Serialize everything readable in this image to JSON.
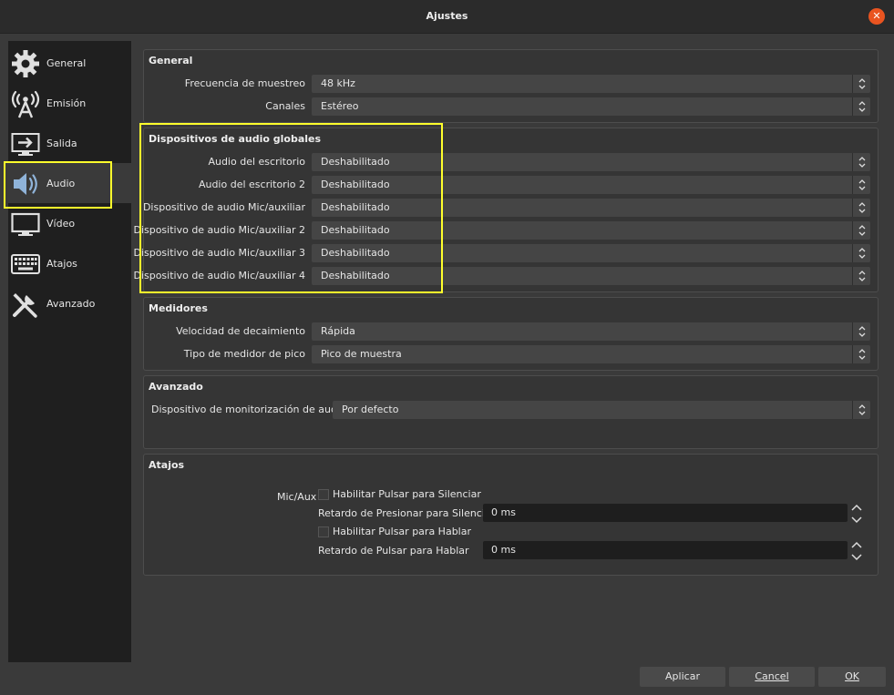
{
  "window": {
    "title": "Ajustes",
    "close_glyph": "✕"
  },
  "sidebar": {
    "items": [
      {
        "label": "General",
        "icon": "gear-icon"
      },
      {
        "label": "Emisión",
        "icon": "broadcast-antenna-icon"
      },
      {
        "label": "Salida",
        "icon": "output-monitor-icon"
      },
      {
        "label": "Audio",
        "icon": "speaker-icon",
        "selected": true
      },
      {
        "label": "Vídeo",
        "icon": "monitor-icon"
      },
      {
        "label": "Atajos",
        "icon": "keyboard-icon"
      },
      {
        "label": "Avanzado",
        "icon": "tools-icon"
      }
    ]
  },
  "general": {
    "title": "General",
    "sample_rate_label": "Frecuencia de muestreo",
    "sample_rate_value": "48 kHz",
    "channels_label": "Canales",
    "channels_value": "Estéreo"
  },
  "global_devices": {
    "title": "Dispositivos de audio globales",
    "rows": [
      {
        "label": "Audio del escritorio",
        "value": "Deshabilitado"
      },
      {
        "label": "Audio del escritorio 2",
        "value": "Deshabilitado"
      },
      {
        "label": "Dispositivo de audio Mic/auxiliar",
        "value": "Deshabilitado"
      },
      {
        "label": "Dispositivo de audio Mic/auxiliar 2",
        "value": "Deshabilitado"
      },
      {
        "label": "Dispositivo de audio Mic/auxiliar 3",
        "value": "Deshabilitado"
      },
      {
        "label": "Dispositivo de audio Mic/auxiliar 4",
        "value": "Deshabilitado"
      }
    ]
  },
  "meters": {
    "title": "Medidores",
    "decay_label": "Velocidad de decaimiento",
    "decay_value": "Rápida",
    "peak_label": "Tipo de medidor de pico",
    "peak_value": "Pico de muestra"
  },
  "advanced": {
    "title": "Avanzado",
    "monitor_label": "Dispositivo de monitorización de audio",
    "monitor_value": "Por defecto"
  },
  "hotkeys": {
    "title": "Atajos",
    "source_label": "Mic/Aux",
    "push_to_mute_label": "Habilitar Pulsar para Silenciar",
    "push_to_mute_checked": false,
    "push_to_mute_delay_label": "Retardo de Presionar para Silenciar",
    "push_to_mute_delay_value": "0 ms",
    "push_to_talk_label": "Habilitar Pulsar para Hablar",
    "push_to_talk_checked": false,
    "push_to_talk_delay_label": "Retardo de Pulsar para Hablar",
    "push_to_talk_delay_value": "0 ms"
  },
  "footer": {
    "apply_label": "Aplicar",
    "cancel_label": "Cancel",
    "ok_label": "OK"
  },
  "colors": {
    "highlight": "#ffff2c",
    "close_button": "#e95420",
    "sidebar_bg": "#1f1f1f",
    "window_bg": "#3a3a3a"
  }
}
